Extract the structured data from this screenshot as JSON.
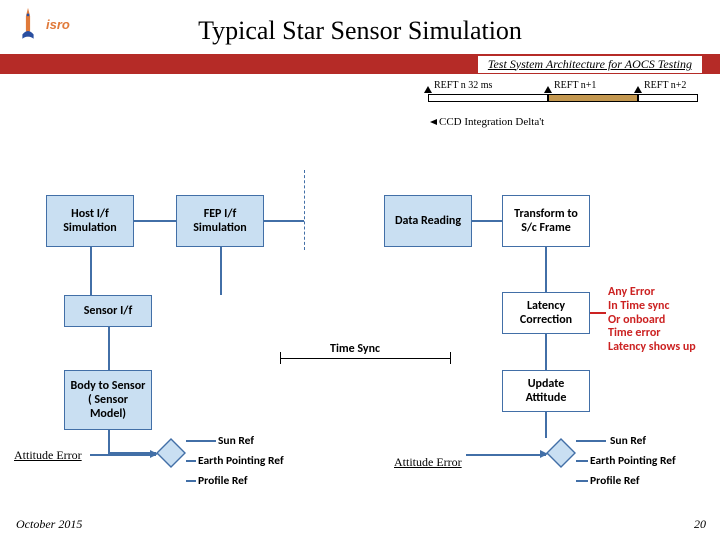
{
  "header": {
    "logo_text": "isro",
    "title": "Typical Star Sensor Simulation",
    "subtitle": "Test System Architecture for AOCS Testing"
  },
  "timeline": {
    "l1": "REFT n   32 ms",
    "l2": "REFT n+1",
    "l3": "REFT n+2",
    "ccd": "CCD Integration Delta't"
  },
  "boxes": {
    "host": "Host I/f Simulation",
    "fep": "FEP I/f Simulation",
    "data": "Data Reading",
    "xform": "Transform to S/c Frame",
    "sensorif": "Sensor I/f",
    "latency": "Latency Correction",
    "b2s": "Body to Sensor ( Sensor Model)",
    "update": "Update Attitude",
    "timesync": "Time Sync"
  },
  "annot": {
    "latency_err": "Any Error\nIn Time sync\nOr onboard\nTime error\nLatency shows up",
    "left_err": "Attitude Error",
    "right_err": "Attitude Error"
  },
  "refs": {
    "sun_l": "Sun Ref",
    "earth_l": "Earth Pointing Ref",
    "profile_l": "Profile Ref",
    "sun_r": "Sun Ref",
    "earth_r": "Earth Pointing Ref",
    "profile_r": "Profile Ref"
  },
  "footer": {
    "date": "October 2015",
    "page": "20"
  }
}
